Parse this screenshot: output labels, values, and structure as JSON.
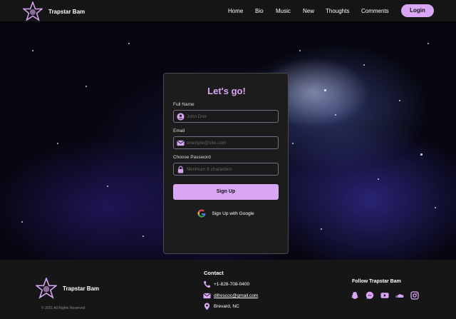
{
  "header": {
    "brand": "Trapstar Bam",
    "nav": [
      "Home",
      "Bio",
      "Music",
      "New",
      "Thoughts",
      "Comments"
    ],
    "login_label": "Login"
  },
  "signup": {
    "title": "Let's go!",
    "full_name_label": "Full Name",
    "full_name_placeholder": "John Doe",
    "email_label": "Email",
    "email_placeholder": "example@site.com",
    "password_label": "Choose Password",
    "password_placeholder": "Minimum 8 characters",
    "submit_label": "Sign Up",
    "google_label": "Sign Up with Google"
  },
  "footer": {
    "brand": "Trapstar Bam",
    "copyright": "© 2021 All Rights Reserved",
    "contact_title": "Contact",
    "phone": "+1-828-708-0400",
    "email": "difrescoc@gmail.com",
    "location": "Brevard, NC",
    "follow_title": "Follow Trapstar Bam",
    "socials": [
      "snapchat-icon",
      "messenger-icon",
      "youtube-icon",
      "soundcloud-icon",
      "instagram-icon"
    ]
  },
  "colors": {
    "accent": "#d9a6f5",
    "background": "#151515",
    "card": "#1c1c1c"
  }
}
